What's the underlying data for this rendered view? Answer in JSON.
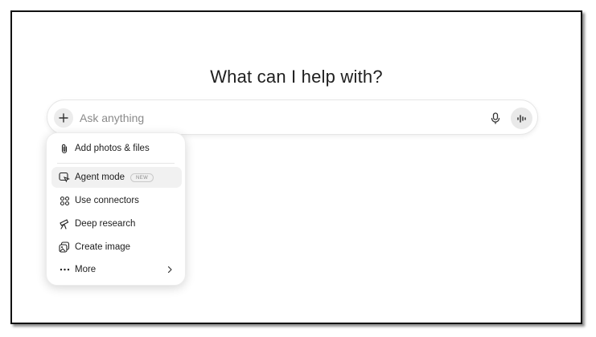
{
  "main": {
    "title": "What can I help with?"
  },
  "composer": {
    "placeholder": "Ask anything",
    "value": ""
  },
  "menu": {
    "items": [
      {
        "label": "Add photos & files",
        "icon": "paperclip-icon"
      },
      {
        "label": "Agent mode",
        "icon": "agent-cursor-icon",
        "badge": "NEW",
        "highlighted": true
      },
      {
        "label": "Use connectors",
        "icon": "connectors-icon"
      },
      {
        "label": "Deep research",
        "icon": "telescope-icon"
      },
      {
        "label": "Create image",
        "icon": "image-icon"
      },
      {
        "label": "More",
        "icon": "more-dots-icon",
        "submenu": true
      }
    ]
  },
  "colors": {
    "accent_bg": "#e9e9e9",
    "text": "#1f1f1f",
    "placeholder": "#8a8a8a"
  }
}
